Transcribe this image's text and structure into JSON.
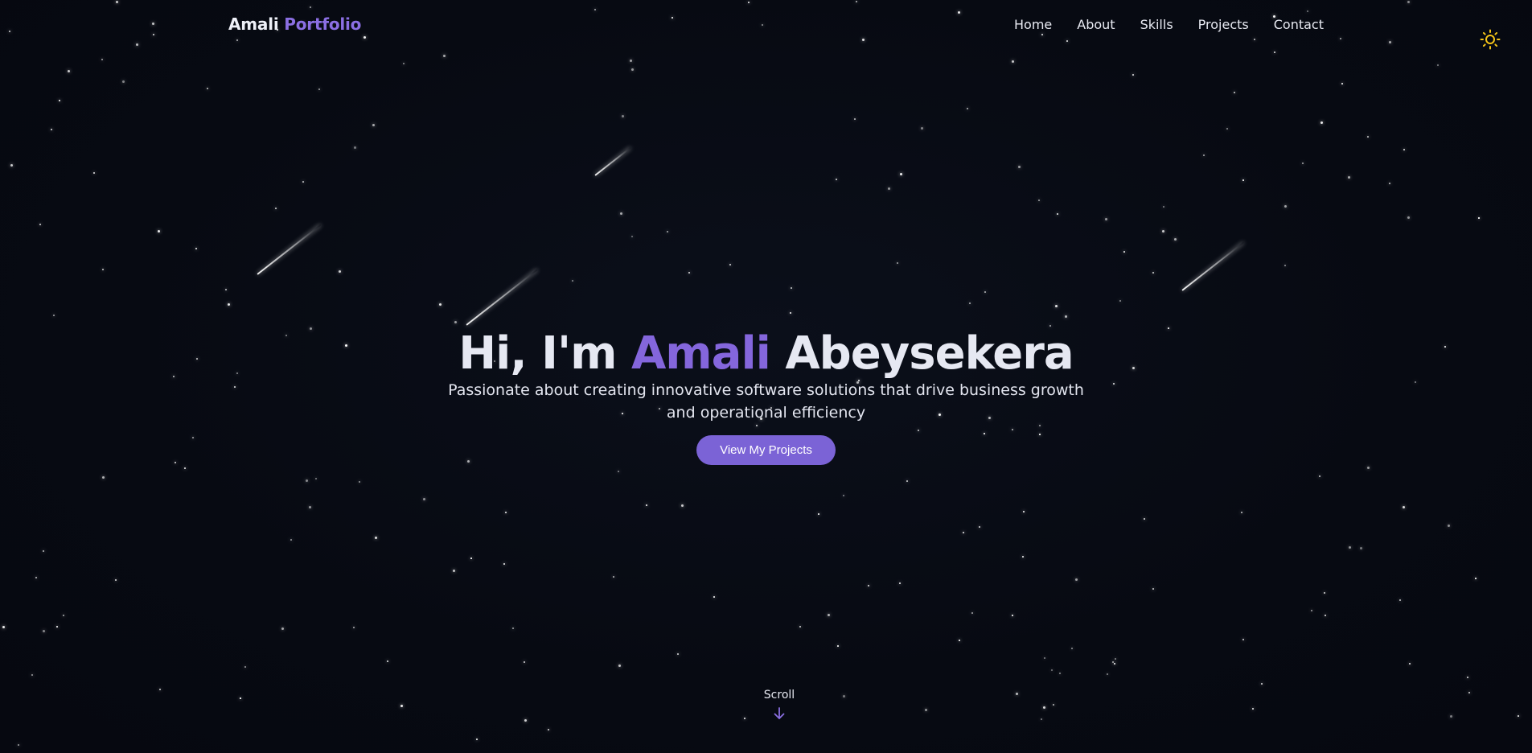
{
  "nav": {
    "brand_first": "Amali",
    "brand_second": "Portfolio",
    "links": [
      "Home",
      "About",
      "Skills",
      "Projects",
      "Contact"
    ],
    "theme_icon": "sun-icon"
  },
  "hero": {
    "greeting": "Hi, I'm",
    "first_name": "Amali",
    "last_name": "Abeysekera",
    "subtitle": "Passionate about creating innovative software solutions that drive business growth and operational efficiency",
    "cta_label": "View My Projects"
  },
  "scroll": {
    "label": "Scroll",
    "icon": "arrow-down-icon"
  },
  "colors": {
    "background": "#070a12",
    "accent": "#8466dc",
    "button": "#7b63d6",
    "sun": "#f5c518"
  }
}
